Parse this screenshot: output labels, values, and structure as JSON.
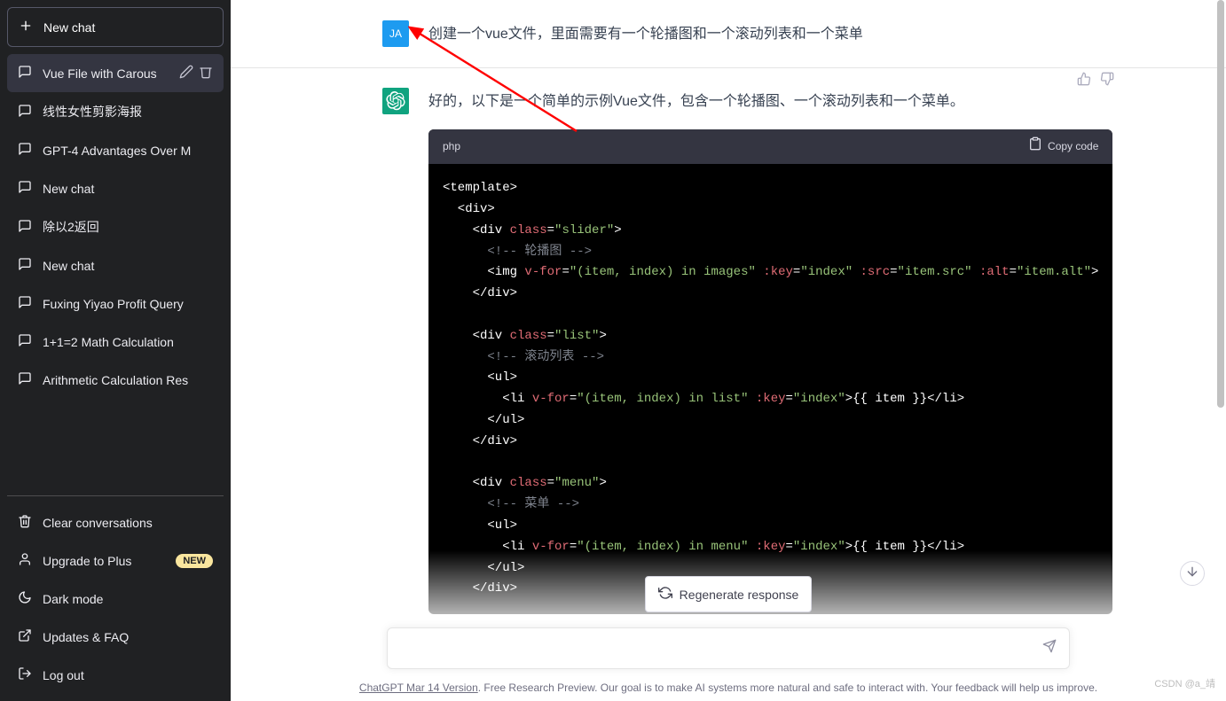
{
  "sidebar": {
    "new_chat_label": "New chat",
    "chats": [
      {
        "label": "Vue File with Carous",
        "active": true
      },
      {
        "label": "线性女性剪影海报",
        "active": false
      },
      {
        "label": "GPT-4 Advantages Over M",
        "active": false
      },
      {
        "label": "New chat",
        "active": false
      },
      {
        "label": "除以2返回",
        "active": false
      },
      {
        "label": "New chat",
        "active": false
      },
      {
        "label": "Fuxing Yiyao Profit Query",
        "active": false
      },
      {
        "label": "1+1=2 Math Calculation",
        "active": false
      },
      {
        "label": "Arithmetic Calculation Res",
        "active": false
      }
    ],
    "footer": {
      "clear": "Clear conversations",
      "upgrade": "Upgrade to Plus",
      "upgrade_badge": "NEW",
      "dark": "Dark mode",
      "faq": "Updates & FAQ",
      "logout": "Log out"
    }
  },
  "conversation": {
    "user_avatar": "JA",
    "user_msg": "创建一个vue文件，里面需要有一个轮播图和一个滚动列表和一个菜单",
    "assistant_msg": "好的，以下是一个简单的示例Vue文件，包含一个轮播图、一个滚动列表和一个菜单。",
    "code_lang": "php",
    "copy_label": "Copy code",
    "code_lines": [
      [
        {
          "t": "tag",
          "v": "<template>"
        }
      ],
      [
        {
          "t": "tag",
          "v": "  <div>"
        }
      ],
      [
        {
          "t": "tag",
          "v": "    <div "
        },
        {
          "t": "attr",
          "v": "class"
        },
        {
          "t": "tag",
          "v": "="
        },
        {
          "t": "str",
          "v": "\"slider\""
        },
        {
          "t": "tag",
          "v": ">"
        }
      ],
      [
        {
          "t": "cmt",
          "v": "      <!-- 轮播图 -->"
        }
      ],
      [
        {
          "t": "tag",
          "v": "      <img "
        },
        {
          "t": "attr",
          "v": "v-for"
        },
        {
          "t": "tag",
          "v": "="
        },
        {
          "t": "str",
          "v": "\"(item, index) in images\""
        },
        {
          "t": "tag",
          "v": " "
        },
        {
          "t": "attr",
          "v": ":key"
        },
        {
          "t": "tag",
          "v": "="
        },
        {
          "t": "str",
          "v": "\"index\""
        },
        {
          "t": "tag",
          "v": " "
        },
        {
          "t": "attr",
          "v": ":src"
        },
        {
          "t": "tag",
          "v": "="
        },
        {
          "t": "str",
          "v": "\"item.src\""
        },
        {
          "t": "tag",
          "v": " "
        },
        {
          "t": "attr",
          "v": ":alt"
        },
        {
          "t": "tag",
          "v": "="
        },
        {
          "t": "str",
          "v": "\"item.alt\""
        },
        {
          "t": "tag",
          "v": ">"
        }
      ],
      [
        {
          "t": "tag",
          "v": "    </div>"
        }
      ],
      [
        {
          "t": "tag",
          "v": ""
        }
      ],
      [
        {
          "t": "tag",
          "v": "    <div "
        },
        {
          "t": "attr",
          "v": "class"
        },
        {
          "t": "tag",
          "v": "="
        },
        {
          "t": "str",
          "v": "\"list\""
        },
        {
          "t": "tag",
          "v": ">"
        }
      ],
      [
        {
          "t": "cmt",
          "v": "      <!-- 滚动列表 -->"
        }
      ],
      [
        {
          "t": "tag",
          "v": "      <ul>"
        }
      ],
      [
        {
          "t": "tag",
          "v": "        <li "
        },
        {
          "t": "attr",
          "v": "v-for"
        },
        {
          "t": "tag",
          "v": "="
        },
        {
          "t": "str",
          "v": "\"(item, index) in list\""
        },
        {
          "t": "tag",
          "v": " "
        },
        {
          "t": "attr",
          "v": ":key"
        },
        {
          "t": "tag",
          "v": "="
        },
        {
          "t": "str",
          "v": "\"index\""
        },
        {
          "t": "tag",
          "v": ">{{ item }}</li>"
        }
      ],
      [
        {
          "t": "tag",
          "v": "      </ul>"
        }
      ],
      [
        {
          "t": "tag",
          "v": "    </div>"
        }
      ],
      [
        {
          "t": "tag",
          "v": ""
        }
      ],
      [
        {
          "t": "tag",
          "v": "    <div "
        },
        {
          "t": "attr",
          "v": "class"
        },
        {
          "t": "tag",
          "v": "="
        },
        {
          "t": "str",
          "v": "\"menu\""
        },
        {
          "t": "tag",
          "v": ">"
        }
      ],
      [
        {
          "t": "cmt",
          "v": "      <!-- 菜单 -->"
        }
      ],
      [
        {
          "t": "tag",
          "v": "      <ul>"
        }
      ],
      [
        {
          "t": "tag",
          "v": "        <li "
        },
        {
          "t": "attr",
          "v": "v-for"
        },
        {
          "t": "tag",
          "v": "="
        },
        {
          "t": "str",
          "v": "\"(item, index) in menu\""
        },
        {
          "t": "tag",
          "v": " "
        },
        {
          "t": "attr",
          "v": ":key"
        },
        {
          "t": "tag",
          "v": "="
        },
        {
          "t": "str",
          "v": "\"index\""
        },
        {
          "t": "tag",
          "v": ">{{ item }}</li>"
        }
      ],
      [
        {
          "t": "tag",
          "v": "      </ul>"
        }
      ],
      [
        {
          "t": "tag",
          "v": "    </div>"
        }
      ]
    ]
  },
  "controls": {
    "regenerate": "Regenerate response",
    "input_placeholder": ""
  },
  "footer": {
    "version_label": "ChatGPT Mar 14 Version",
    "rest": ". Free Research Preview. Our goal is to make AI systems more natural and safe to interact with. Your feedback will help us improve."
  },
  "watermark": "CSDN @a_靖"
}
